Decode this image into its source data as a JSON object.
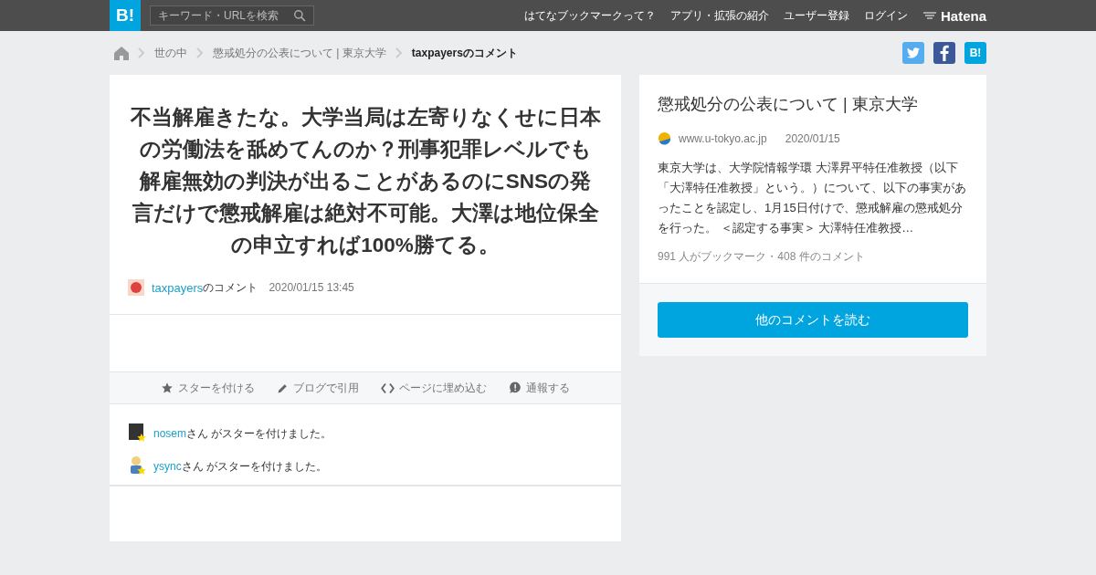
{
  "header": {
    "logo": "B!",
    "search": {
      "placeholder": "キーワード・URLを検索"
    },
    "nav": [
      "はてなブックマークって？",
      "アプリ・拡張の紹介",
      "ユーザー登録",
      "ログイン"
    ],
    "brand": "Hatena"
  },
  "breadcrumb": [
    {
      "label": "世の中",
      "current": false
    },
    {
      "label": "懲戒処分の公表について | 東京大学",
      "current": false
    },
    {
      "label": "taxpayersのコメント",
      "current": true
    }
  ],
  "share": [
    {
      "kind": "twitter"
    },
    {
      "kind": "facebook"
    },
    {
      "kind": "hatena",
      "label": "B!"
    }
  ],
  "comment": {
    "text": "不当解雇きたな。大学当局は左寄りなくせに日本の労働法を舐めてんのか？刑事犯罪レベルでも解雇無効の判決が出ることがあるのにSNSの発言だけで懲戒解雇は絶対不可能。大澤は地位保全の申立すれば100%勝てる。",
    "user": "taxpayers",
    "suffix": "のコメント",
    "time": "2020/01/15 13:45"
  },
  "actions": [
    {
      "kind": "star",
      "label": "スターを付ける"
    },
    {
      "kind": "pencil",
      "label": "ブログで引用"
    },
    {
      "kind": "code",
      "label": "ページに埋め込む"
    },
    {
      "kind": "report",
      "label": "通報する"
    }
  ],
  "stars": [
    {
      "user": "nosem",
      "text": "さん がスターを付けました。",
      "kind": "device"
    },
    {
      "user": "ysync",
      "text": "さん がスターを付けました。",
      "kind": "person"
    }
  ],
  "entry": {
    "title": "懲戒処分の公表について | 東京大学",
    "domain": "www.u-tokyo.ac.jp",
    "date": "2020/01/15",
    "summary": "東京大学は、大学院情報学環 大澤昇平特任准教授（以下「大澤特任准教授」という。）について、以下の事実があったことを認定し、1月15日付けで、懲戒解雇の懲戒処分を行った。 ＜認定する事実＞ 大澤特任准教授…",
    "counts": "991 人がブックマーク・408 件のコメント",
    "button": "他のコメントを読む"
  }
}
